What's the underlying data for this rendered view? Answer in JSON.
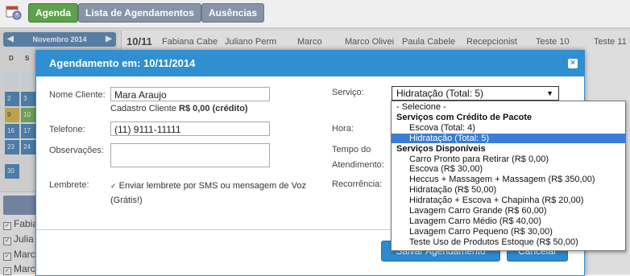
{
  "top_tabs": {
    "agenda": "Agenda",
    "lista": "Lista de Agendamentos",
    "ausencias": "Ausências"
  },
  "calendar": {
    "month_label": "Novembro 2014",
    "prev": "◀",
    "next": "▶",
    "dow": [
      "D",
      "S"
    ],
    "visible_days": [
      "2",
      "3",
      "9",
      "10",
      "16",
      "17",
      "23",
      "24",
      "30"
    ]
  },
  "professionals": [
    "Fabia",
    "Julia",
    "Marc",
    "Marc"
  ],
  "schedule": {
    "date": "10/11",
    "staff": [
      "Fabiana Cabe",
      "Juliano Perm",
      "Marco",
      "Marco Olivei",
      "Paula Cabele",
      "Recepcionist",
      "Teste 10",
      "Teste 11"
    ]
  },
  "modal": {
    "title": "Agendamento em: 10/11/2014",
    "close": "×",
    "nome_label": "Nome Cliente:",
    "nome_value": "Mara Araujo",
    "cadastro_prefix": "Cadastro Cliente",
    "cadastro_value": "R$ 0,00 (crédito)",
    "telefone_label": "Telefone:",
    "telefone_value": "(11) 9111-11111",
    "obs_label": "Observações:",
    "lembrete_label": "Lembrete:",
    "lembrete_text": "Enviar lembrete por SMS ou mensagem de Voz",
    "lembrete_text2": "(Grátis!)",
    "servico_label": "Serviço:",
    "servico_value": "Hidratação (Total: 5)",
    "hora_label": "Hora:",
    "tempo_label": "Tempo do",
    "tempo_label2": "Atendimento:",
    "recorrencia_label": "Recorrência:",
    "save_button": "Salvar Agendamento",
    "cancel_button": "Cancelar"
  },
  "dropdown": {
    "options": [
      {
        "text": "- Selecione -",
        "kind": "top"
      },
      {
        "text": "Serviços com Crédito de Pacote",
        "kind": "grp"
      },
      {
        "text": "Escova (Total: 4)",
        "kind": "ind"
      },
      {
        "text": "Hidratação (Total: 5)",
        "kind": "ind",
        "selected": true
      },
      {
        "text": "Serviços Disponíveis",
        "kind": "grp"
      },
      {
        "text": "Carro Pronto para Retirar (R$ 0,00)",
        "kind": "ind"
      },
      {
        "text": "Escova (R$ 30,00)",
        "kind": "ind"
      },
      {
        "text": "Heccus + Massagem + Massagem (R$ 350,00)",
        "kind": "ind"
      },
      {
        "text": "Hidratação (R$ 50,00)",
        "kind": "ind"
      },
      {
        "text": "Hidratação + Escova + Chapinha (R$ 20,00)",
        "kind": "ind"
      },
      {
        "text": "Lavagem Carro Grande (R$ 60,00)",
        "kind": "ind"
      },
      {
        "text": "Lavagem Carro Médio (R$ 40,00)",
        "kind": "ind"
      },
      {
        "text": "Lavagem Carro Pequeno (R$ 30,00)",
        "kind": "ind"
      },
      {
        "text": "Teste Uso de Produtos Estoque (R$ 50,00)",
        "kind": "ind"
      }
    ]
  }
}
